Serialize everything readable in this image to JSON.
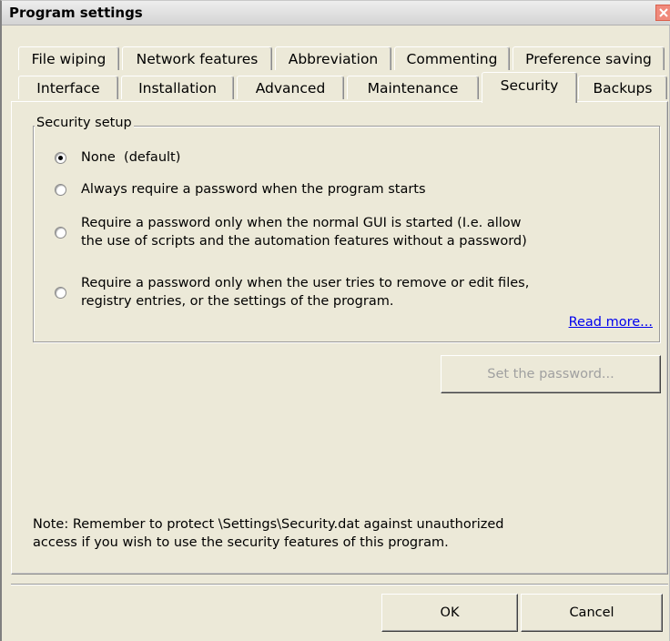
{
  "window": {
    "title": "Program settings"
  },
  "tabs": {
    "row1": [
      {
        "label": "File wiping"
      },
      {
        "label": "Network features"
      },
      {
        "label": "Abbreviation"
      },
      {
        "label": "Commenting"
      },
      {
        "label": "Preference saving"
      }
    ],
    "row2": [
      {
        "label": "Interface"
      },
      {
        "label": "Installation"
      },
      {
        "label": "Advanced"
      },
      {
        "label": "Maintenance"
      },
      {
        "label": "Security"
      },
      {
        "label": "Backups"
      }
    ],
    "active": "Security"
  },
  "security": {
    "group_label": "Security setup",
    "options": [
      {
        "line1": "None  (default)",
        "checked": true
      },
      {
        "line1": "Always require a password when the program starts",
        "checked": false
      },
      {
        "line1": "Require a password only when the normal GUI is started (I.e. allow",
        "line2": "the use of scripts and the automation features without a password)",
        "checked": false
      },
      {
        "line1": "Require a password only when the user tries to remove or edit files,",
        "line2": "registry entries, or the settings of the program.",
        "checked": false
      }
    ],
    "read_more": "Read more...",
    "set_password": "Set the password..."
  },
  "note": {
    "line1": "Note: Remember to protect \\Settings\\Security.dat against unauthorized",
    "line2": "access if you wish to use the security features of this program."
  },
  "buttons": {
    "ok": "OK",
    "cancel": "Cancel"
  }
}
